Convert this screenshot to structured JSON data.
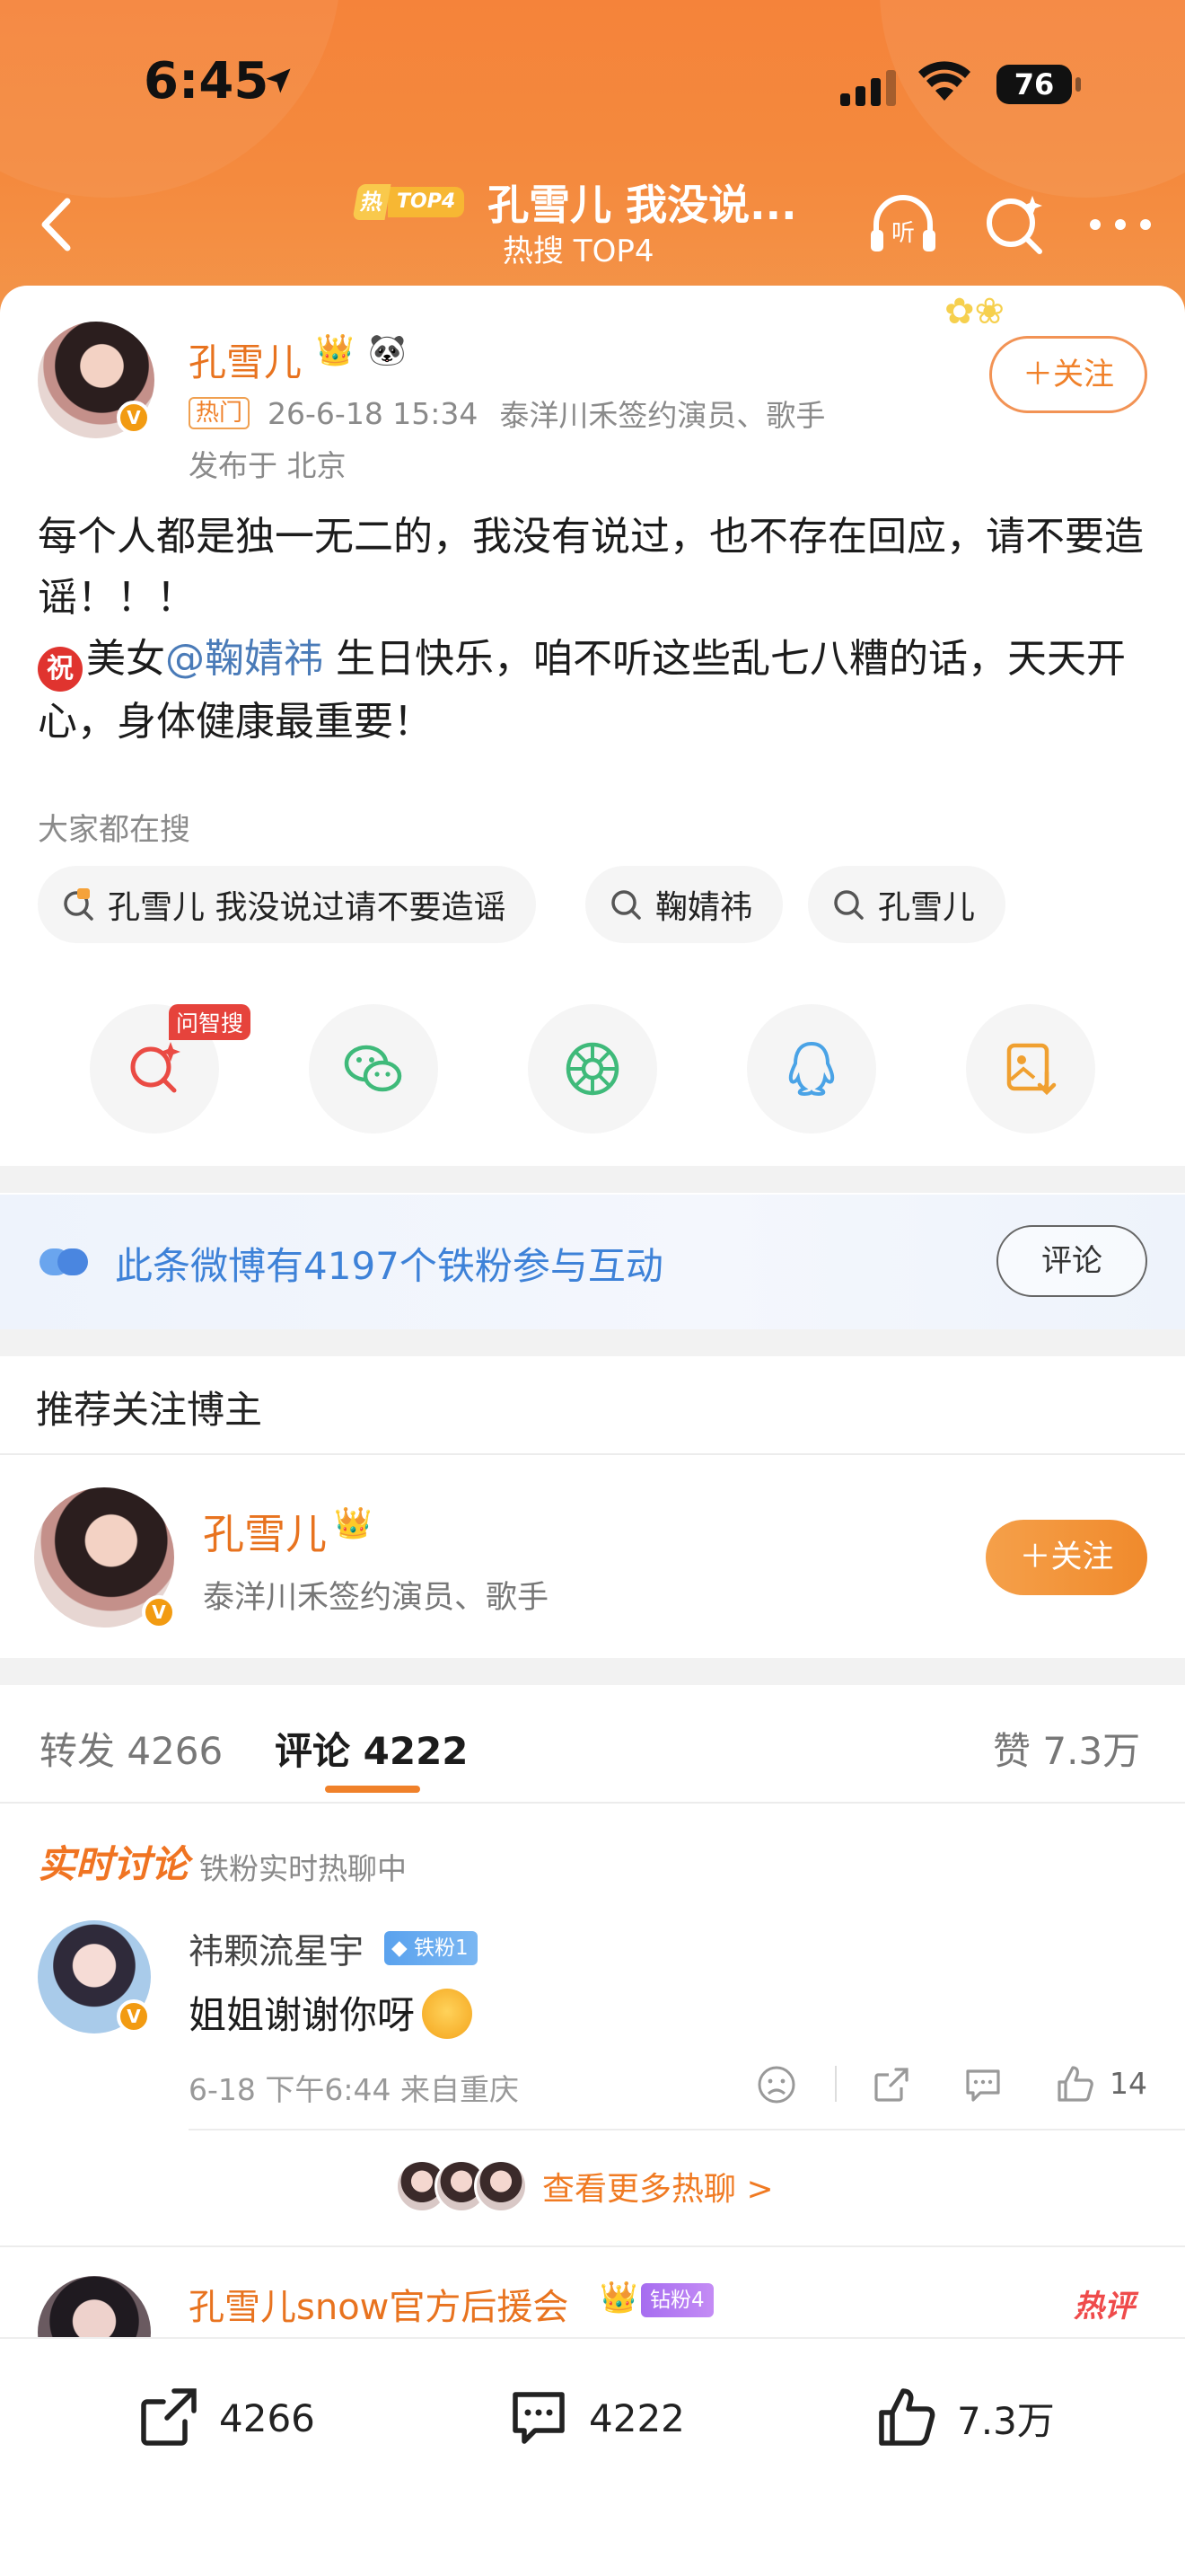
{
  "status_bar": {
    "time": "6:45",
    "battery": "76"
  },
  "nav": {
    "hot_badge": "热",
    "top_badge": "TOP4",
    "title": "孔雪儿 我没说...",
    "subtitle": "热搜 TOP4",
    "listen_label": "听"
  },
  "post": {
    "author": "孔雪儿",
    "hot_tag": "热门",
    "time": "26-6-18 15:34",
    "author_desc": "泰洋川禾签约演员、歌手",
    "location": "发布于 北京",
    "follow_label": "＋关注",
    "text_line1": "每个人都是独一无二的，我没有说过，也不存在回应，请不要造谣！！！",
    "wish_icon": "祝",
    "text_pre_mention": "美女",
    "mention": "@鞠婧祎",
    "text_post_mention": " 生日快乐，咱不听这些乱七八糟的话，天天开心，身体健康最重要！"
  },
  "search": {
    "label": "大家都在搜",
    "chips": [
      "孔雪儿 我没说过请不要造谣",
      "鞠婧祎",
      "孔雪儿"
    ]
  },
  "share": {
    "wzs_tag": "问智搜"
  },
  "fans": {
    "text": "此条微博有4197个铁粉参与互动",
    "comment_label": "评论"
  },
  "recommend": {
    "title": "推荐关注博主",
    "name": "孔雪儿",
    "desc": "泰洋川禾签约演员、歌手",
    "follow_label": "＋关注"
  },
  "tabs": {
    "repost": "转发 4266",
    "comments": "评论 4222",
    "likes": "赞 7.3万"
  },
  "live": {
    "title": "实时讨论",
    "subtitle": "铁粉实时热聊中",
    "comment": {
      "name": "祎颗流星宇",
      "badge": "铁粉1",
      "text": "姐姐谢谢你呀",
      "meta": "6-18 下午6:44 来自重庆",
      "likes": "14"
    },
    "more": "查看更多热聊 >"
  },
  "comment2": {
    "name": "孔雪儿snow官方后援会",
    "badge": "钻粉4",
    "tag": "热评"
  },
  "bottom": {
    "reposts": "4266",
    "comments": "4222",
    "likes": "7.3万"
  },
  "colors": {
    "header": "#f5833a",
    "accent": "#f0812a",
    "link": "#4a7bb8",
    "fans_text": "#3e82d8"
  }
}
